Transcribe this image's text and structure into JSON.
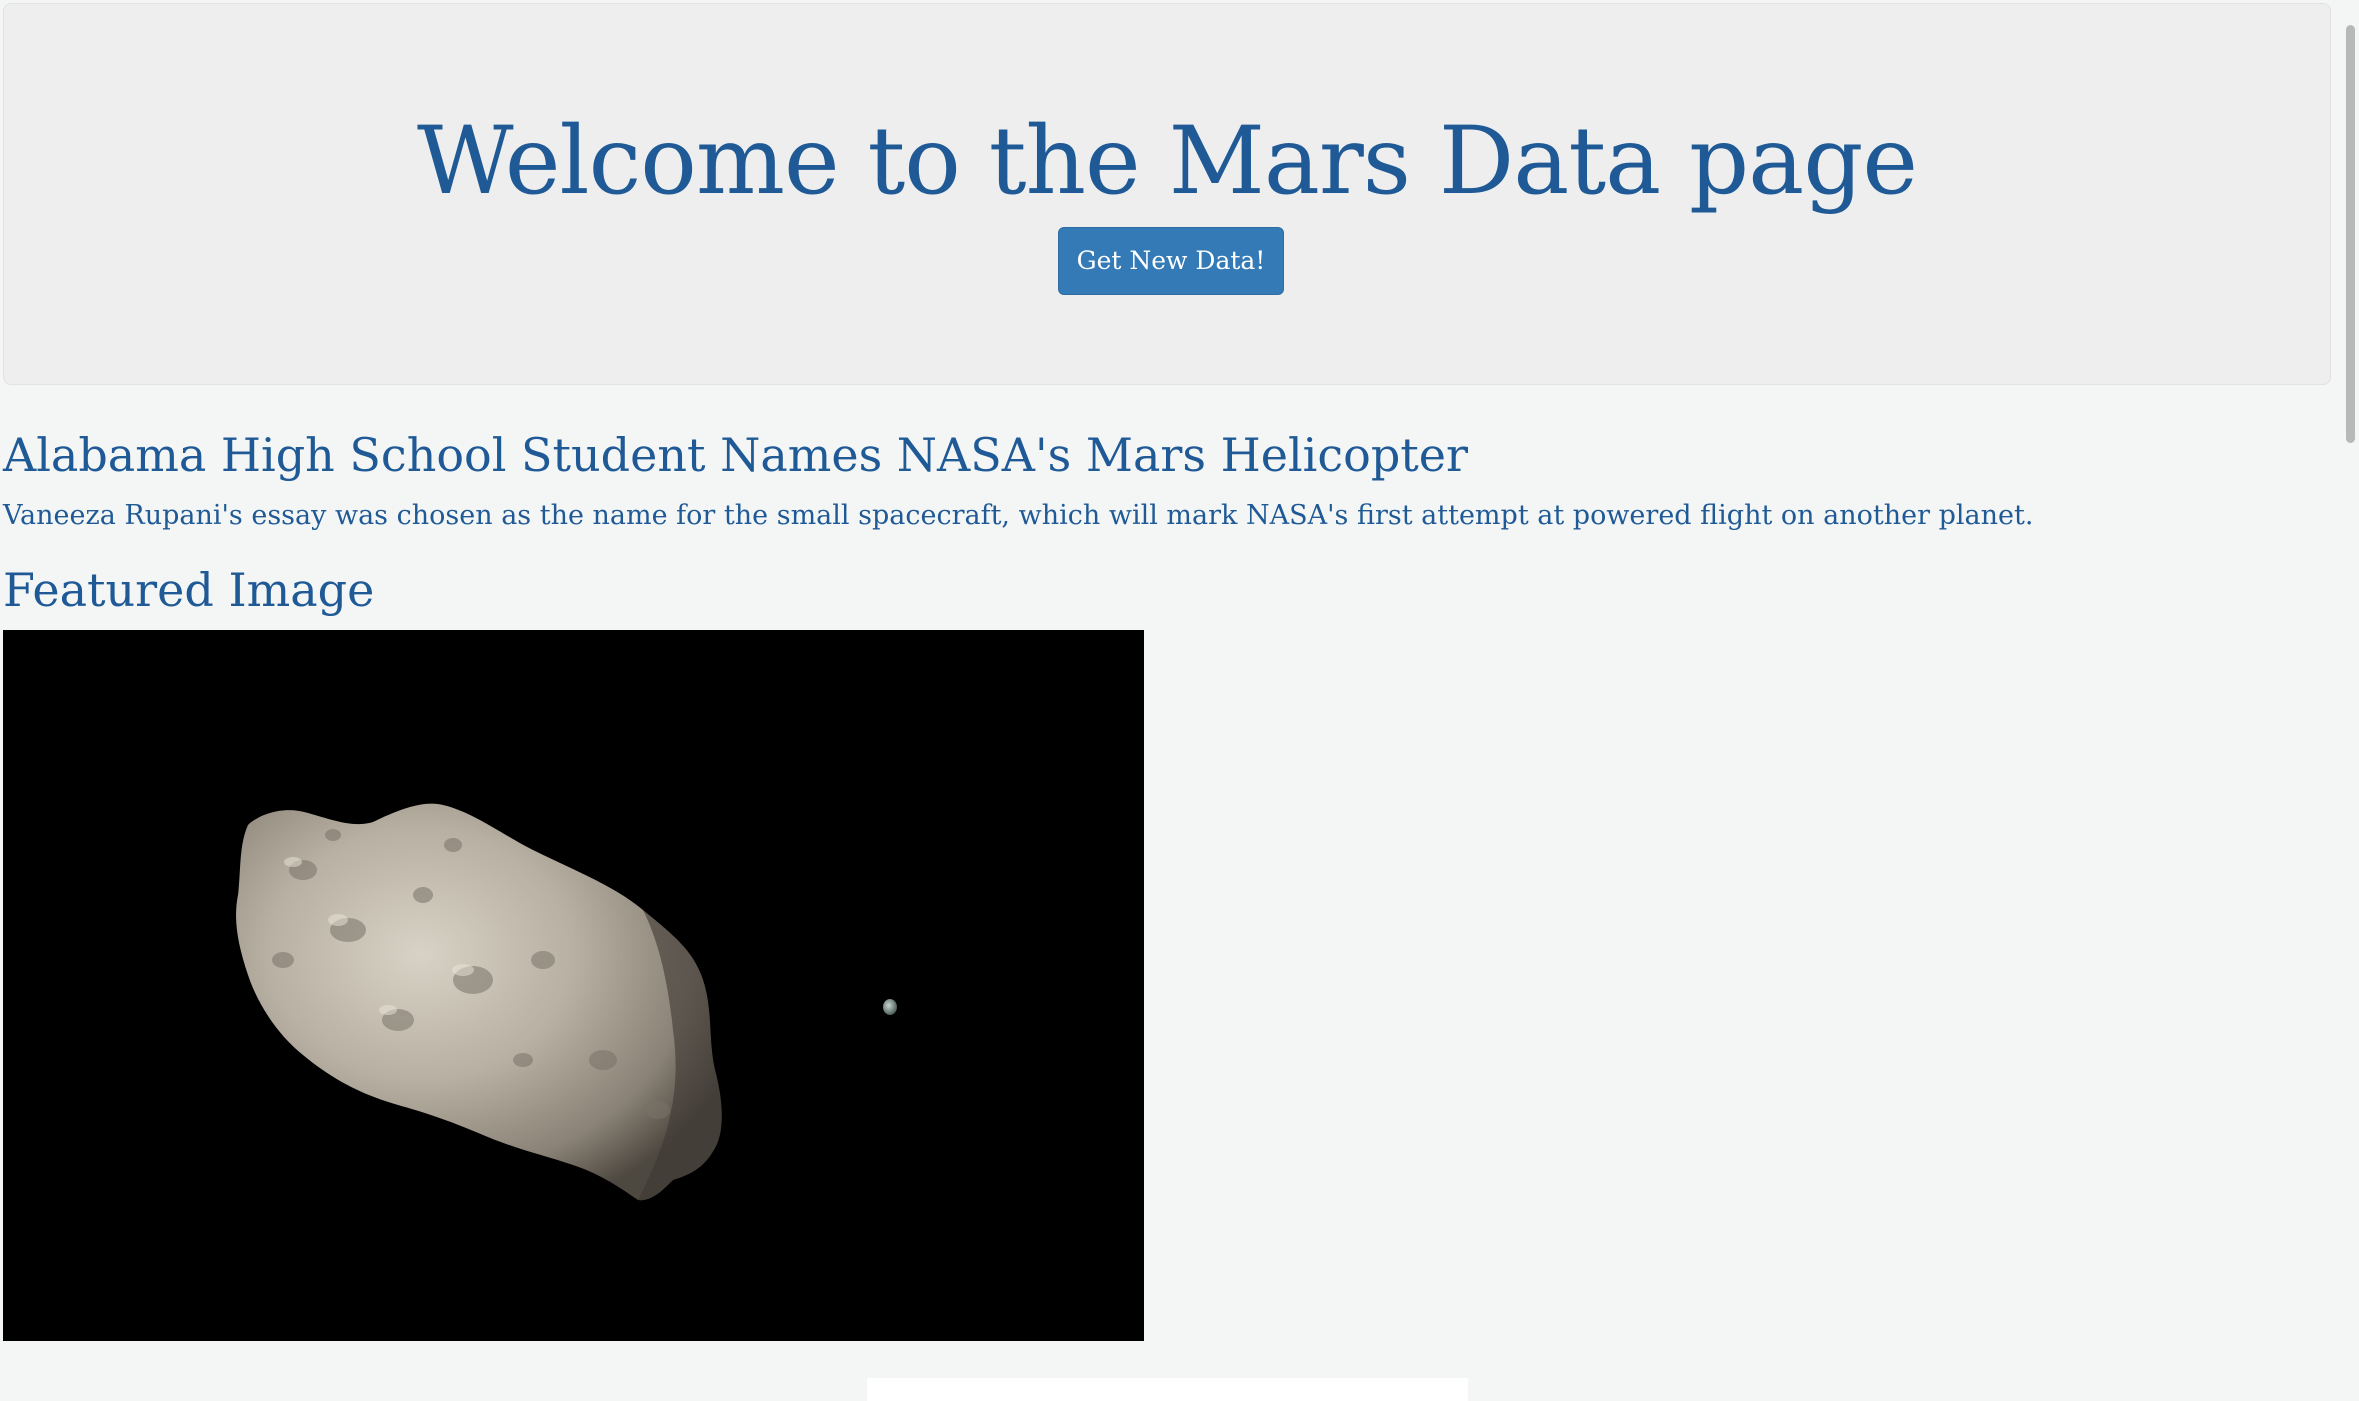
{
  "header": {
    "title": "Welcome to the Mars Data page",
    "button_label": "Get New Data!"
  },
  "news": {
    "title": "Alabama High School Student Names NASA's Mars Helicopter",
    "paragraph": "Vaneeza Rupani's essay was chosen as the name for the small spacecraft, which will mark NASA's first attempt at powered flight on another planet."
  },
  "featured": {
    "heading": "Featured Image"
  },
  "colors": {
    "accent": "#1f5a96",
    "button": "#337ab7",
    "jumbotron": "#eeeeee",
    "background": "#f4f6f6"
  }
}
